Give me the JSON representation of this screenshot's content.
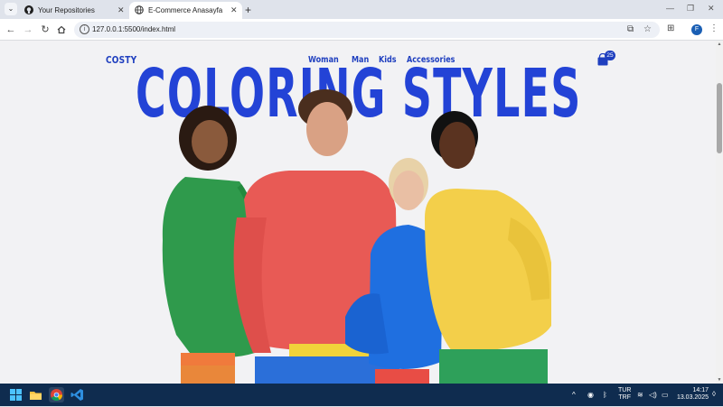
{
  "browser": {
    "tabs": [
      {
        "title": "Your Repositories",
        "icon": "github-icon",
        "active": false
      },
      {
        "title": "E-Commerce Anasayfa",
        "icon": "globe-icon",
        "active": true
      }
    ],
    "new_tab_label": "+",
    "url": "127.0.0.1:5500/index.html"
  },
  "site": {
    "logo": "COSTY",
    "nav": [
      "Woman",
      "Man",
      "Kids",
      "Accessories"
    ],
    "cart_count": "25",
    "hero_title": "COLORING STYLES",
    "brand_color": "#1f3fbf",
    "hero_image_desc": "four-models-in-colorful-hoodies"
  },
  "taskbar": {
    "apps": [
      "windows-start-icon",
      "file-explorer-icon",
      "chrome-icon",
      "vscode-icon"
    ],
    "lang_top": "TUR",
    "lang_bottom": "TRF",
    "time": "14:17",
    "date": "13.03.2025"
  }
}
